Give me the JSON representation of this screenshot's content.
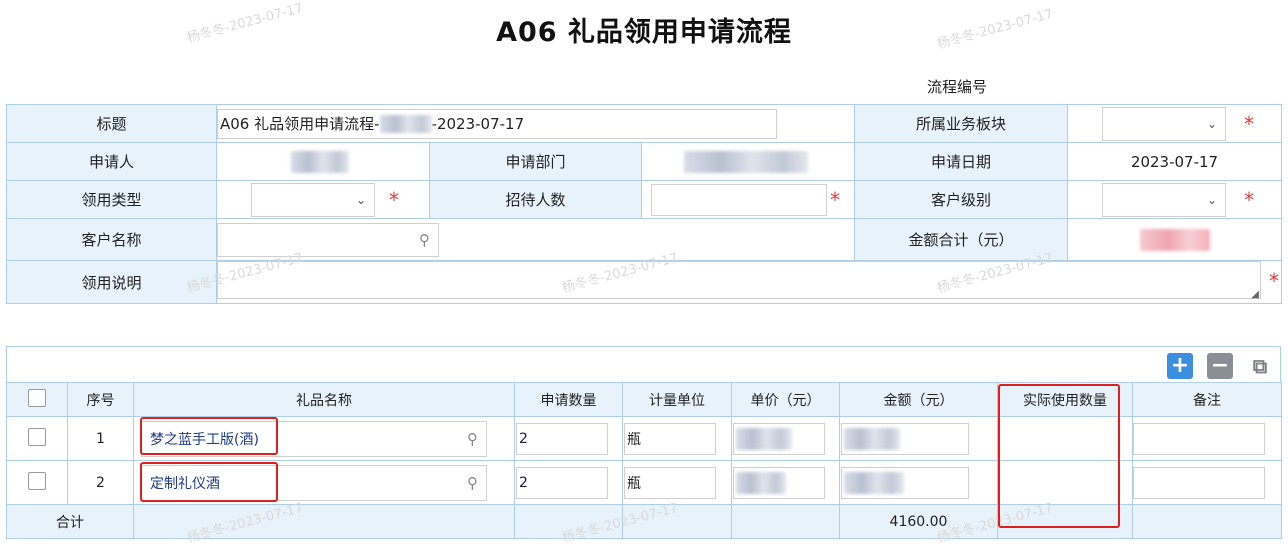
{
  "page": {
    "title": "A06 礼品领用申请流程",
    "process_no_label": "流程编号",
    "watermark": "杨冬冬-2023-07-17"
  },
  "form": {
    "title_label": "标题",
    "title_value": "A06 礼品领用申请流程-",
    "title_date": "-2023-07-17",
    "business_label": "所属业务板块",
    "applicant_label": "申请人",
    "dept_label": "申请部门",
    "apply_date_label": "申请日期",
    "apply_date_value": "2023-07-17",
    "type_label": "领用类型",
    "guests_label": "招待人数",
    "client_level_label": "客户级别",
    "client_name_label": "客户名称",
    "amount_total_label": "金额合计（元）",
    "desc_label": "领用说明",
    "required_mark": "*",
    "chevron_glyph": "⌄",
    "search_glyph": "⚲"
  },
  "colors": {
    "accent_blue": "#3c8ee0",
    "label_bg": "#e8f2fb",
    "border": "#aecde6",
    "required_red": "#e03a3a",
    "highlight_red": "#e0201c"
  },
  "toolbar": {
    "add_glyph": "+",
    "remove_glyph": "−",
    "copy_glyph": "⧉",
    "add_icon": "plus-icon",
    "remove_icon": "minus-icon",
    "copy_icon": "copy-icon"
  },
  "grid": {
    "headers": [
      "序号",
      "礼品名称",
      "申请数量",
      "计量单位",
      "单价（元）",
      "金额（元）",
      "实际使用数量",
      "备注"
    ],
    "rows": [
      {
        "no": "1",
        "gift": "梦之蓝手工版(酒)",
        "qty": "2",
        "unit": "瓶"
      },
      {
        "no": "2",
        "gift": "定制礼仪酒",
        "qty": "2",
        "unit": "瓶"
      }
    ],
    "summary_label": "合计",
    "summary_amount": "4160.00"
  }
}
